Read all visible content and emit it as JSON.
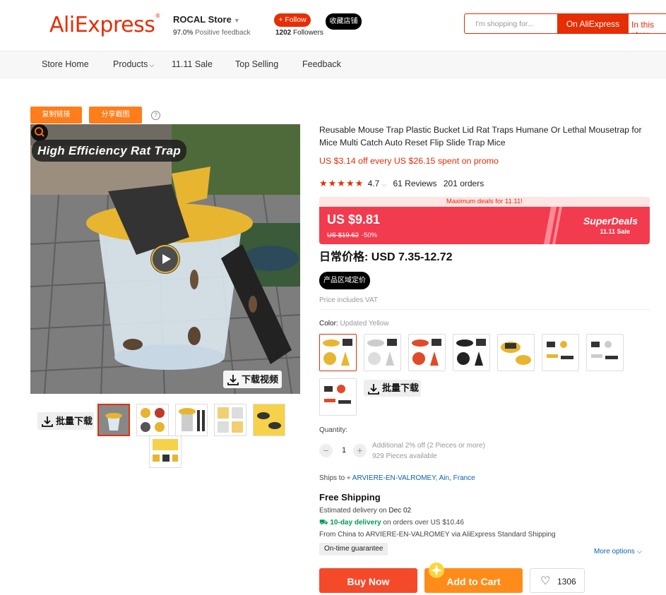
{
  "header": {
    "logo": "AliExpress",
    "store_name": "ROCAL Store",
    "feedback_pct": "97.0%",
    "feedback_label": "Positive feedback",
    "follow_label": "+ Follow",
    "followers_count": "1202",
    "followers_label": "Followers",
    "collect_label": "收藏店铺",
    "search_placeholder": "I'm shopping for...",
    "search_on_aliexpress": "On AliExpress",
    "search_in_store": "In this store"
  },
  "nav": {
    "items": [
      "Store Home",
      "Products",
      "11.11 Sale",
      "Top Selling",
      "Feedback"
    ]
  },
  "gallery": {
    "copy_link": "复制链接",
    "share_screenshot": "分享截图",
    "help": "?",
    "image_title": "High Efficiency Rat Trap",
    "download_video": "下载视频",
    "bulk_download": "批量下载"
  },
  "product": {
    "title": "Reusable Mouse Trap Plastic Bucket Lid Rat Traps Humane Or Lethal Mousetrap for Mice Multi Catch Auto Reset Flip Slide Trap Mice",
    "promo": "US $3.14 off every US $26.15 spent on promo",
    "rating": "4.7",
    "reviews": "61 Reviews",
    "orders": "201 orders",
    "max_deals": "Maximum deals for 11.11!",
    "price": "US $9.81",
    "old_price": "US $19.62",
    "discount": "-50%",
    "superdeals": "SuperDeals",
    "sale_label": "11.11 Sale",
    "daily_price": "日常价格: USD 7.35-12.72",
    "region_price_btn": "产品区域定价",
    "vat": "Price includes VAT",
    "color_label": "Color:",
    "color_value": "Updated Yellow",
    "bulk_download2": "批量下载",
    "quantity_label": "Quantity:",
    "quantity": "1",
    "additional": "Additional 2% off (2 Pieces or more)",
    "available": "929 Pieces available",
    "ships_to_label": "Ships to",
    "ships_to": "ARVIERE-EN-VALROMEY, Ain, France",
    "free_shipping": "Free Shipping",
    "est_delivery_label": "Estimated delivery on",
    "est_delivery_date": "Dec 02",
    "ten_day": "10-day delivery",
    "ten_day_rest": "on orders over US $10.46",
    "from_china": "From China to ARVIERE-EN-VALROMEY via AliExpress Standard Shipping",
    "on_time": "On-time guarantee",
    "more_options": "More options",
    "buy_now": "Buy Now",
    "add_to_cart": "Add to Cart",
    "wish_count": "1306"
  },
  "colors": {
    "brand": "#e62e04",
    "superdeals_bg": "#f23b4e",
    "buy_now": "#f54a2a",
    "add_to_cart": "#ff8c1a",
    "link": "#0d5fb8",
    "delivery_green": "#009b52"
  }
}
